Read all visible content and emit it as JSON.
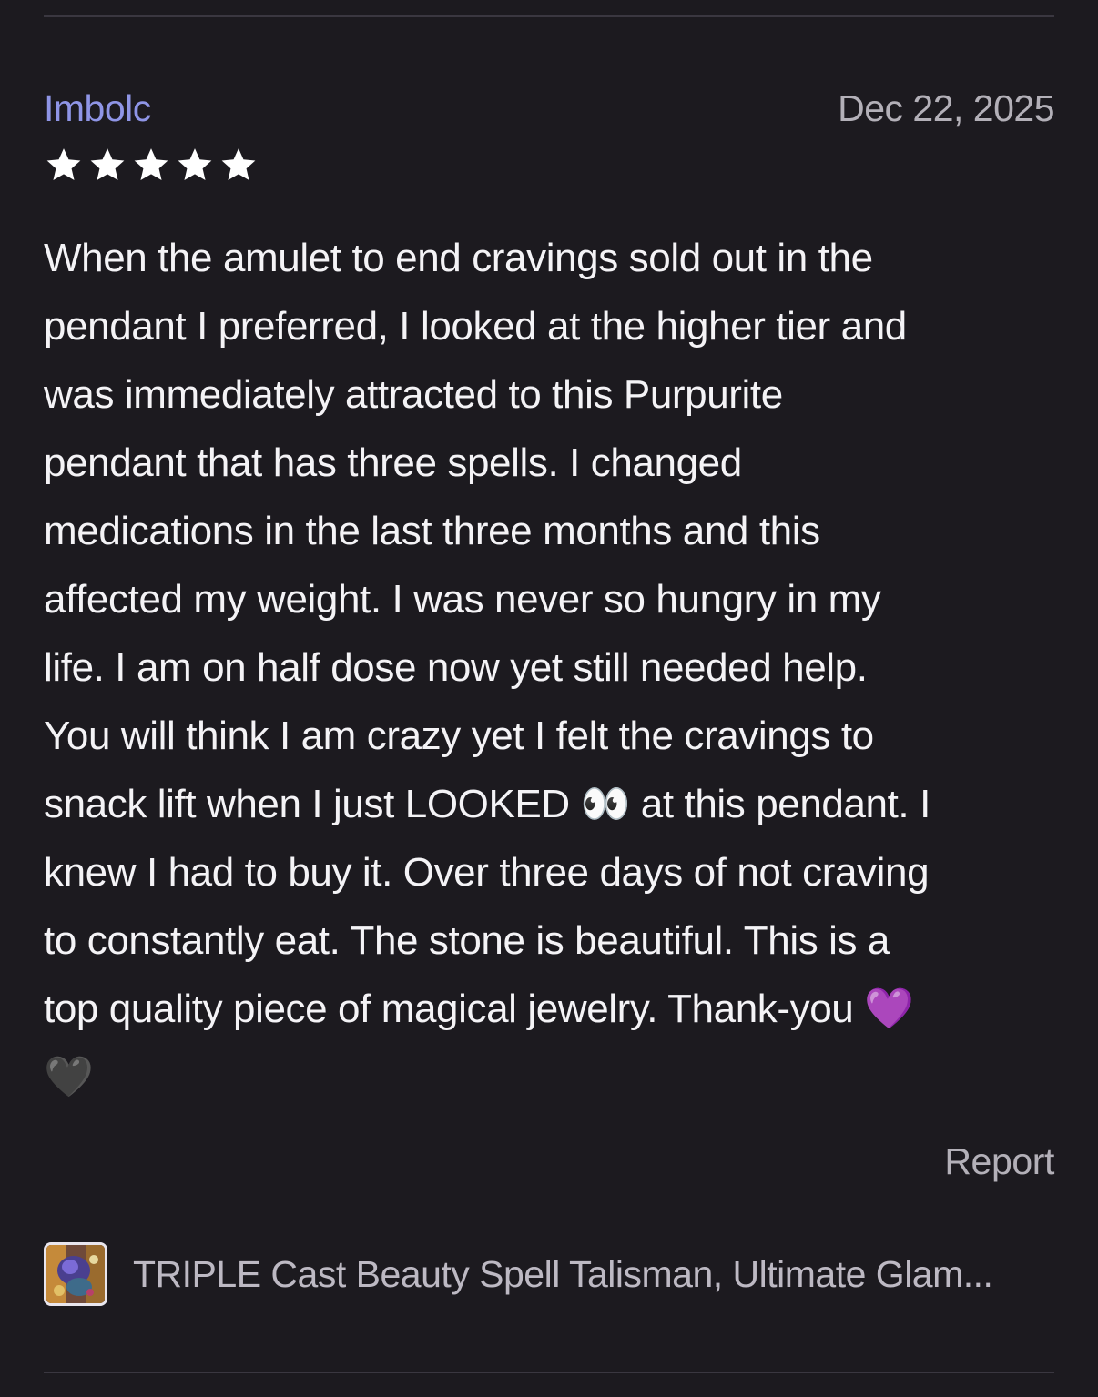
{
  "review": {
    "reviewer_name": "Imbolc",
    "date": "Dec 22, 2025",
    "rating": 5,
    "rating_max": 5,
    "body_lines": [
      "When the amulet to end cravings sold out in the",
      "pendant I preferred, I looked at the higher tier and",
      "was immediately attracted to this Purpurite",
      "pendant that has three spells. I changed",
      "medications in the last three months and this",
      "affected my weight. I was never so hungry in my",
      "life. I am on half dose now yet still needed help.",
      "You will think I am crazy yet I felt the cravings to",
      "snack lift when I just LOOKED 👀 at this pendant. I",
      "knew I had to buy it. Over three days of not craving",
      "to constantly eat. The stone is beautiful. This is a",
      "top quality piece of magical jewelry. Thank-you 💜",
      "🖤"
    ],
    "report_label": "Report"
  },
  "product": {
    "title": "TRIPLE Cast Beauty Spell Talisman, Ultimate Glam...",
    "thumbnail_icon": "product-thumbnail"
  },
  "colors": {
    "background": "#1c1a1f",
    "reviewer_name": "#8f95e6",
    "body_text": "#f4f3f6",
    "muted_text": "#b3b0b8",
    "star": "#ffffff",
    "divider": "#3a3740"
  }
}
